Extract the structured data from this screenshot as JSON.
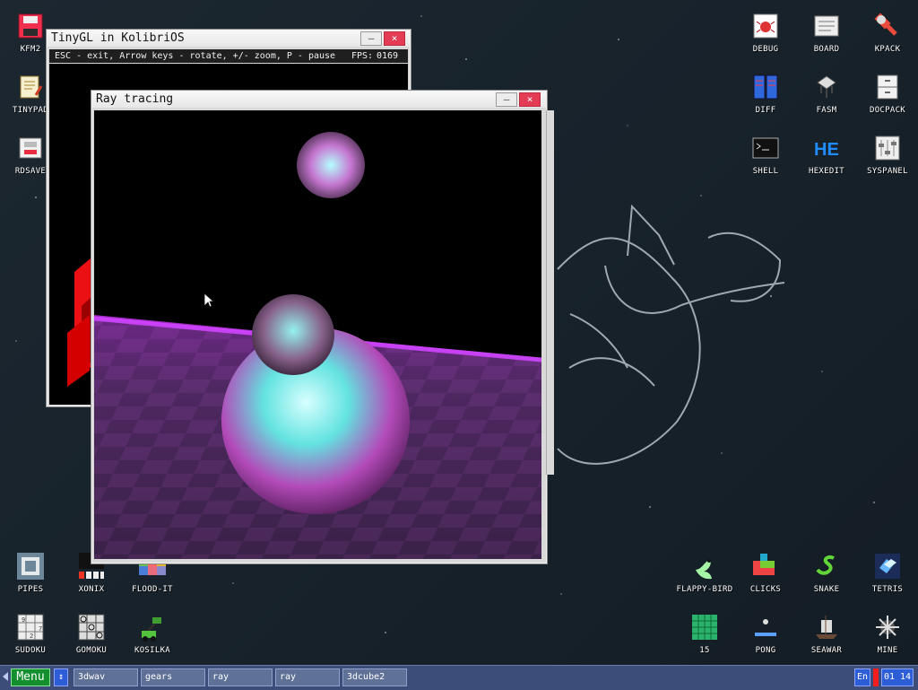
{
  "desktop": {
    "left_icons": [
      {
        "label": "KFM2"
      },
      {
        "label": "TINYPAD"
      },
      {
        "label": "RDSAVE"
      },
      {
        "label": "PIPES"
      },
      {
        "label": "XONIX"
      },
      {
        "label": "FLOOD-IT"
      },
      {
        "label": "SUDOKU"
      },
      {
        "label": "GOMOKU"
      },
      {
        "label": "KOSILKA"
      }
    ],
    "right_icons": [
      {
        "label": "DEBUG"
      },
      {
        "label": "BOARD"
      },
      {
        "label": "KPACK"
      },
      {
        "label": "DIFF"
      },
      {
        "label": "FASM"
      },
      {
        "label": "DOCPACK"
      },
      {
        "label": "SHELL"
      },
      {
        "label": "HEXEDIT"
      },
      {
        "label": "SYSPANEL"
      },
      {
        "label": "FLAPPY-BIRD"
      },
      {
        "label": "CLICKS"
      },
      {
        "label": "SNAKE"
      },
      {
        "label": "TETRIS"
      },
      {
        "label": "15"
      },
      {
        "label": "PONG"
      },
      {
        "label": "SEAWAR"
      },
      {
        "label": "MINE"
      }
    ]
  },
  "windows": {
    "tinygl": {
      "title": "TinyGL in KolibriOS",
      "status": "ESC - exit, Arrow keys - rotate, +/- zoom, P - pause",
      "fps_label": "FPS:",
      "fps_value": "0169",
      "minimize": "—",
      "close": "×"
    },
    "ray": {
      "title": "Ray tracing",
      "minimize": "—",
      "close": "×"
    }
  },
  "taskbar": {
    "menu": "Menu",
    "switch": "↕",
    "tasks": [
      "3dwav",
      "gears",
      "ray",
      "ray",
      "3dcube2"
    ],
    "language": "En",
    "time": "01 14"
  },
  "colors": {
    "desktop": "#18232c",
    "taskbar": "#3c4d79",
    "menu": "#148f2e",
    "close": "#e53c56"
  }
}
